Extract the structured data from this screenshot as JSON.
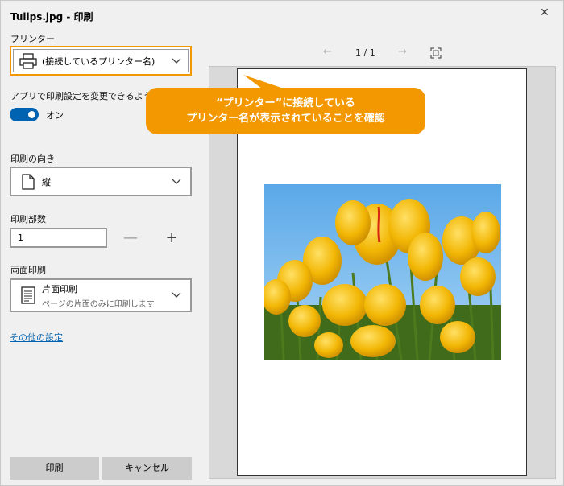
{
  "window": {
    "title": "Tulips.jpg - 印刷",
    "close_glyph": "✕"
  },
  "printer": {
    "label": "プリンター",
    "selected": "(接続しているプリンター名)"
  },
  "app_settings": {
    "label": "アプリで印刷設定を変更できるように",
    "toggle_state": "オン"
  },
  "orientation": {
    "label": "印刷の向き",
    "selected": "縦"
  },
  "copies": {
    "label": "印刷部数",
    "value": "1",
    "minus": "—",
    "plus": "+"
  },
  "duplex": {
    "label": "両面印刷",
    "selected": "片面印刷",
    "description": "ページの片面のみに印刷します"
  },
  "more_settings": {
    "link": "その他の設定"
  },
  "buttons": {
    "print": "印刷",
    "cancel": "キャンセル"
  },
  "preview": {
    "page_indicator": "1 / 1",
    "prev_glyph": "←",
    "next_glyph": "→"
  },
  "callout": {
    "line1": "“プリンター”に接続している",
    "line2": "プリンター名が表示されていることを確認"
  },
  "colors": {
    "accent": "#0063b1",
    "callout": "#f39800"
  }
}
